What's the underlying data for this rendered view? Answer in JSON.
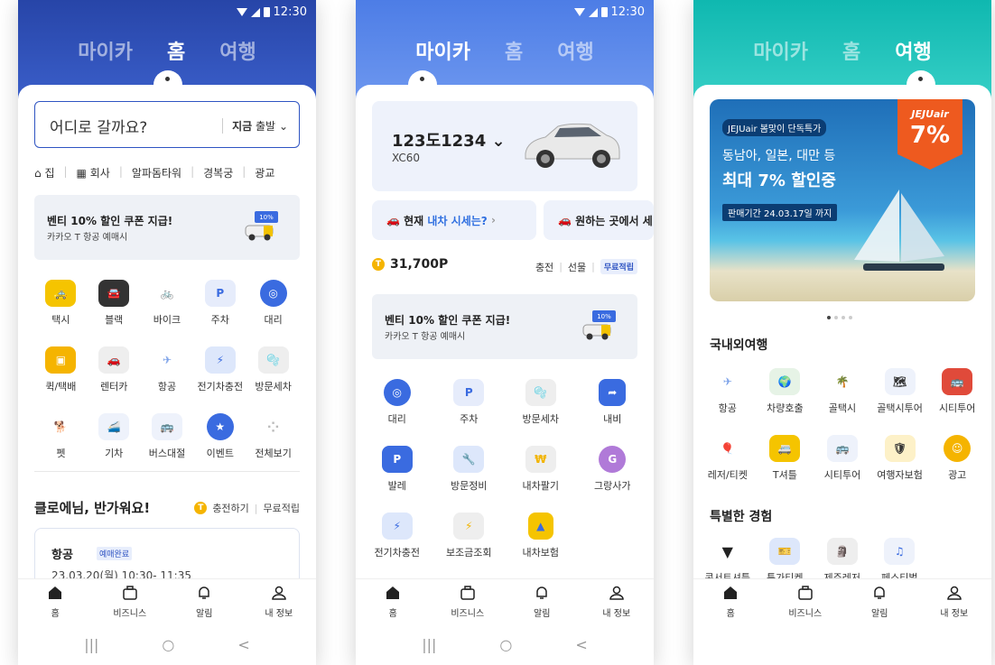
{
  "status": {
    "time": "12:30"
  },
  "tabs": [
    "마이카",
    "홈",
    "여행"
  ],
  "bottom_nav": [
    "홈",
    "비즈니스",
    "알림",
    "내 정보"
  ],
  "sysnav": [
    "|||",
    "○",
    "<"
  ],
  "home": {
    "search_placeholder": "어디로 갈까요?",
    "departure_strong": "지금",
    "departure_rest": "출발",
    "quick": [
      "집",
      "회사",
      "알파돔타워",
      "경복궁",
      "광교"
    ],
    "banner": {
      "title": "벤티 10% 할인 쿠폰 지급!",
      "sub": "카카오 T 항공 예매시",
      "tag": "10%"
    },
    "services": [
      "택시",
      "블랙",
      "바이크",
      "주차",
      "대리",
      "퀵/택배",
      "렌터카",
      "항공",
      "전기차충전",
      "방문세차",
      "펫",
      "기차",
      "버스대절",
      "이벤트",
      "전체보기"
    ],
    "welcome": "클로에님, 반가워요!",
    "charge": "충전하기",
    "free": "무료적립",
    "trip": {
      "title": "항공",
      "badge": "예매완료",
      "date": "23.03.20(월) 10:30- 11:35"
    }
  },
  "mycar": {
    "plate": "123도1234",
    "model": "XC60",
    "chip1_a": "현재",
    "chip1_hl": "내차 시세는?",
    "chip2": "원하는 곳에서 세",
    "points": "31,700P",
    "charge": "충전",
    "gift": "선물",
    "free": "무료적립",
    "banner": {
      "title": "벤티 10% 할인 쿠폰 지급!",
      "sub": "카카오 T 항공 예매시",
      "tag": "10%"
    },
    "services": [
      "대리",
      "주차",
      "방문세차",
      "내비",
      "발레",
      "방문정비",
      "내차팔기",
      "그랑사가",
      "전기차충전",
      "보조금조회",
      "내차보험"
    ]
  },
  "travel": {
    "promo": {
      "brand": "JEJUair 봄맞이 단독특가",
      "line1": "동남아, 일본, 대만 등",
      "line2": "최대 7% 할인중",
      "period": "판매기간 24.03.17일 까지",
      "flag_brand": "JEJUair",
      "flag_pct": "7%"
    },
    "section1": "국내외여행",
    "services1": [
      "항공",
      "차량호출",
      "골택시",
      "골택시투어",
      "시티투어",
      "레저/티켓",
      "T셔틀",
      "시티투어",
      "여행자보험",
      "광고"
    ],
    "section2": "특별한 경험",
    "services2": [
      "콘서트셔틀",
      "특가티켓",
      "제주레저",
      "페스티벌"
    ]
  },
  "colors": {
    "home_header": "#2745a8",
    "mycar_header": "#4d7de6",
    "travel_header": "#0fb8b0",
    "accent": "#2f54c2"
  }
}
